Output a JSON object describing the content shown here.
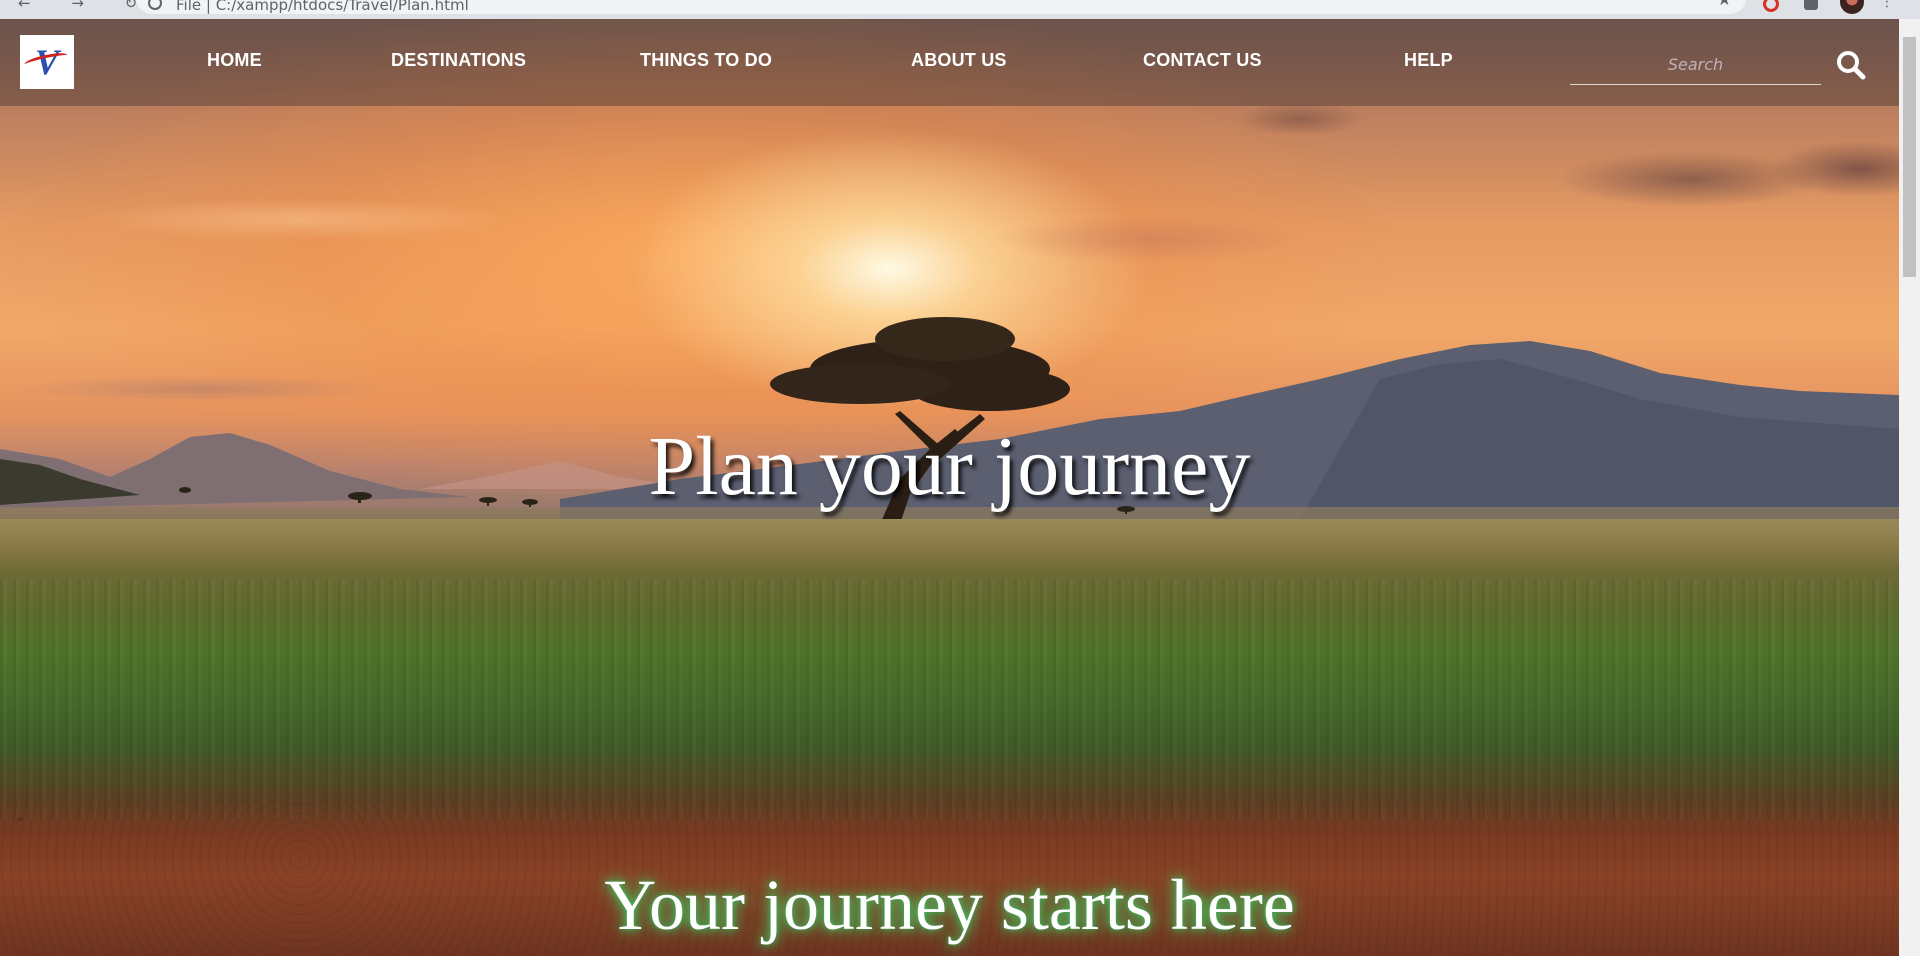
{
  "browser": {
    "address_text": "File  |  C:/xampp/htdocs/Travel/Plan.html",
    "back_forward_glyphs": "← → ↻"
  },
  "nav": {
    "logo_letter": "V",
    "links": [
      "HOME",
      "DESTINATIONS",
      "THINGS TO DO",
      "ABOUT US",
      "CONTACT US",
      "HELP"
    ],
    "search": {
      "placeholder": "Search",
      "value": ""
    }
  },
  "hero": {
    "title": "Plan your journey",
    "subtitle": "Your journey starts here"
  },
  "colors": {
    "nav_text": "#ffffff",
    "subtitle_glow": "#46dc6e",
    "logo_blue": "#2a4fb0",
    "logo_red": "#d32020"
  },
  "icons": {
    "search": "search-icon",
    "star": "star-icon"
  }
}
